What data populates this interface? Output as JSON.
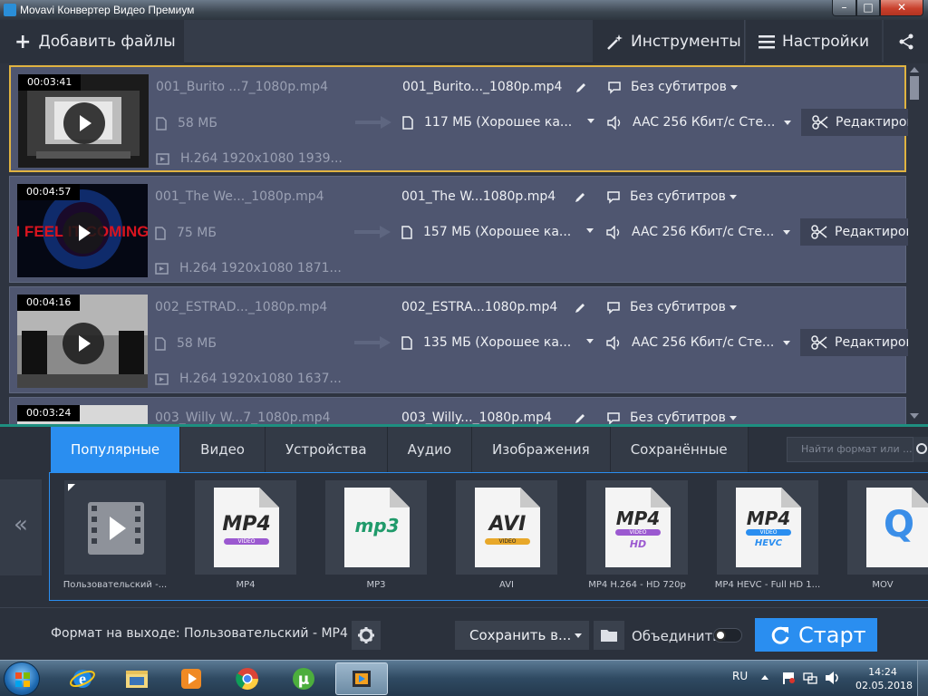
{
  "window": {
    "title": "Movavi Конвертер Видео Премиум",
    "minimize": "–",
    "maximize": "□",
    "close": "✕"
  },
  "toolbar": {
    "add_files": "Добавить файлы",
    "tools": "Инструменты",
    "settings": "Настройки"
  },
  "files": [
    {
      "duration": "00:03:41",
      "source_name": "001_Burito ...7_1080p.mp4",
      "source_size": "58 МБ",
      "source_codec": "H.264 1920x1080 1939...",
      "output_name": "001_Burito..._1080p.mp4",
      "output_size": "117 МБ (Хорошее ка...",
      "subtitles": "Без субтитров",
      "audio": "AAC 256 Кбит/с Сте...",
      "edit": "Редактиров"
    },
    {
      "duration": "00:04:57",
      "source_name": "001_The We..._1080p.mp4",
      "source_size": "75 МБ",
      "source_codec": "H.264 1920x1080 1871...",
      "output_name": "001_The W...1080p.mp4",
      "output_size": "157 МБ (Хорошее ка...",
      "subtitles": "Без субтитров",
      "audio": "AAC 256 Кбит/с Сте...",
      "edit": "Редактиров",
      "thumb_text": "I FEEL IT COMING"
    },
    {
      "duration": "00:04:16",
      "source_name": "002_ESTRAD..._1080p.mp4",
      "source_size": "58 МБ",
      "source_codec": "H.264 1920x1080 1637...",
      "output_name": "002_ESTRA...1080p.mp4",
      "output_size": "135 МБ (Хорошее ка...",
      "subtitles": "Без субтитров",
      "audio": "AAC 256 Кбит/с Сте...",
      "edit": "Редактиров"
    },
    {
      "duration": "00:03:24",
      "source_name": "003_Willy W...7_1080p.mp4",
      "output_name": "003_Willy..._1080p.mp4",
      "subtitles": "Без субтитров"
    }
  ],
  "format_tabs": [
    "Популярные",
    "Видео",
    "Устройства",
    "Аудио",
    "Изображения",
    "Сохранённые"
  ],
  "format_search_placeholder": "Найти формат или ...",
  "formats": [
    {
      "label": "Пользовательский -...",
      "badge": "",
      "sub": ""
    },
    {
      "label": "MP4",
      "badge": "MP4",
      "sub": "VIDEO"
    },
    {
      "label": "MP3",
      "badge": "mp3",
      "sub": ""
    },
    {
      "label": "AVI",
      "badge": "AVI",
      "sub": "VIDEO"
    },
    {
      "label": "MP4 H.264 - HD 720p",
      "badge": "MP4",
      "sub": "VIDEO",
      "sub2": "HD"
    },
    {
      "label": "MP4 HEVC - Full HD 1...",
      "badge": "MP4",
      "sub": "VIDEO",
      "sub2": "HEVC"
    },
    {
      "label": "MOV",
      "badge": "Q",
      "sub": ""
    }
  ],
  "left_nav": "«",
  "bottom": {
    "output_format": "Формат на выходе: Пользовательский - MP4",
    "save_in": "Сохранить в...",
    "merge": "Объединить",
    "start": "Старт"
  },
  "taskbar": {
    "language": "RU",
    "time": "14:24",
    "date": "02.05.2018"
  },
  "colors": {
    "accent_blue": "#2a8ef0",
    "selected_border": "#e0b341",
    "row_bg": "#4f5670",
    "panel_bg": "#2b313c",
    "teal_divider": "#1e8f80"
  }
}
